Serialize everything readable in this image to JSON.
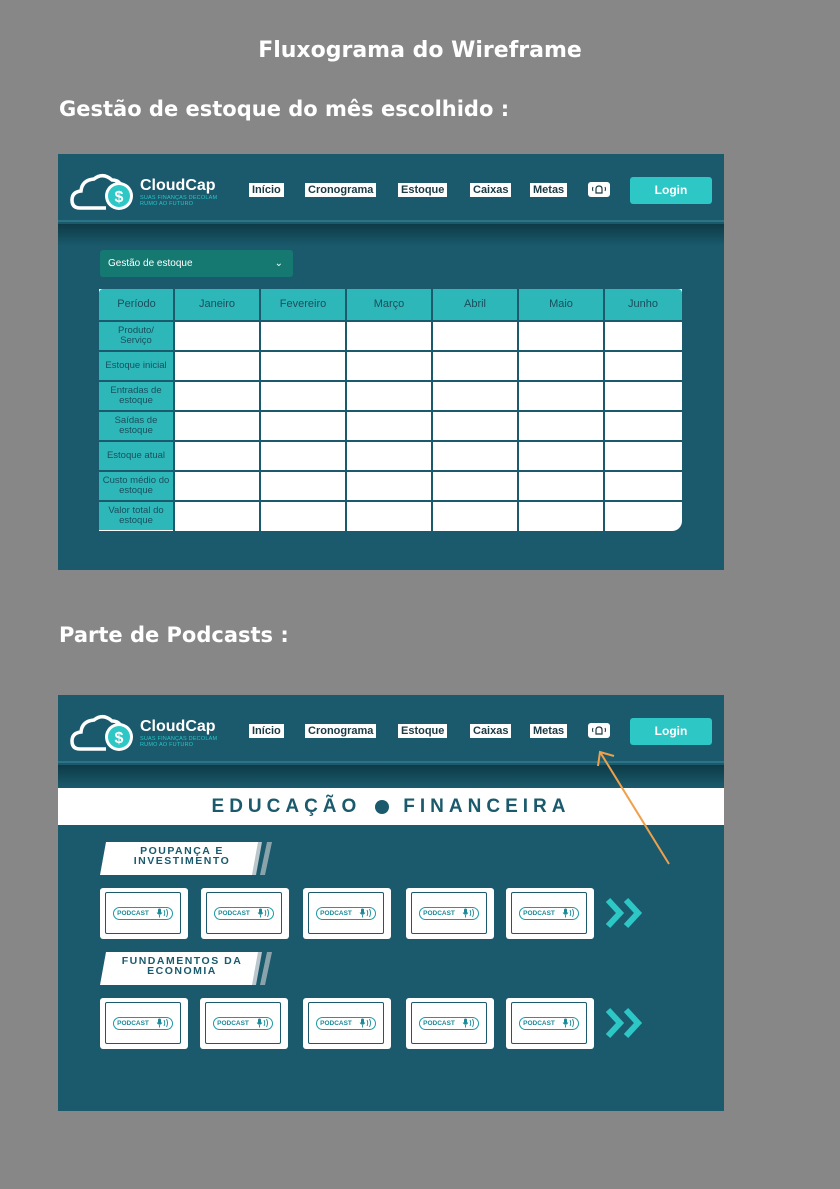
{
  "page_title": "Fluxograma do Wireframe",
  "section1_title": "Gestão de estoque do mês escolhido :",
  "section2_title": "Parte de Podcasts :",
  "colors": {
    "background": "#878787",
    "panel": "#1a5a6c",
    "accent": "#2dc7c6",
    "arrow": "#f0a04b"
  },
  "nav": {
    "brand": "CloudCap",
    "tagline": "SUAS FINANÇAS DECOLAM RUMO AO FUTURO",
    "items": [
      "Início",
      "Cronograma",
      "Estoque",
      "Caixas",
      "Metas"
    ],
    "bell_icon": "bell-icon",
    "login": "Login"
  },
  "inventory": {
    "dropdown": "Gestão de estoque",
    "columns": [
      "Período",
      "Janeiro",
      "Fevereiro",
      "Março",
      "Abril",
      "Maio",
      "Junho"
    ],
    "rows": [
      "Produto/ Serviço",
      "Estoque inicial",
      "Entradas de estoque",
      "Saídas de estoque",
      "Estoque atual",
      "Custo médio do estoque",
      "Valor total do estoque"
    ]
  },
  "podcasts": {
    "banner_left": "EDUCAÇÃO",
    "banner_right": "FINANCEIRA",
    "categories": [
      "POUPANÇA E INVESTIMENTO",
      "FUNDAMENTOS DA ECONOMIA"
    ],
    "card_label": "PODCAST"
  }
}
